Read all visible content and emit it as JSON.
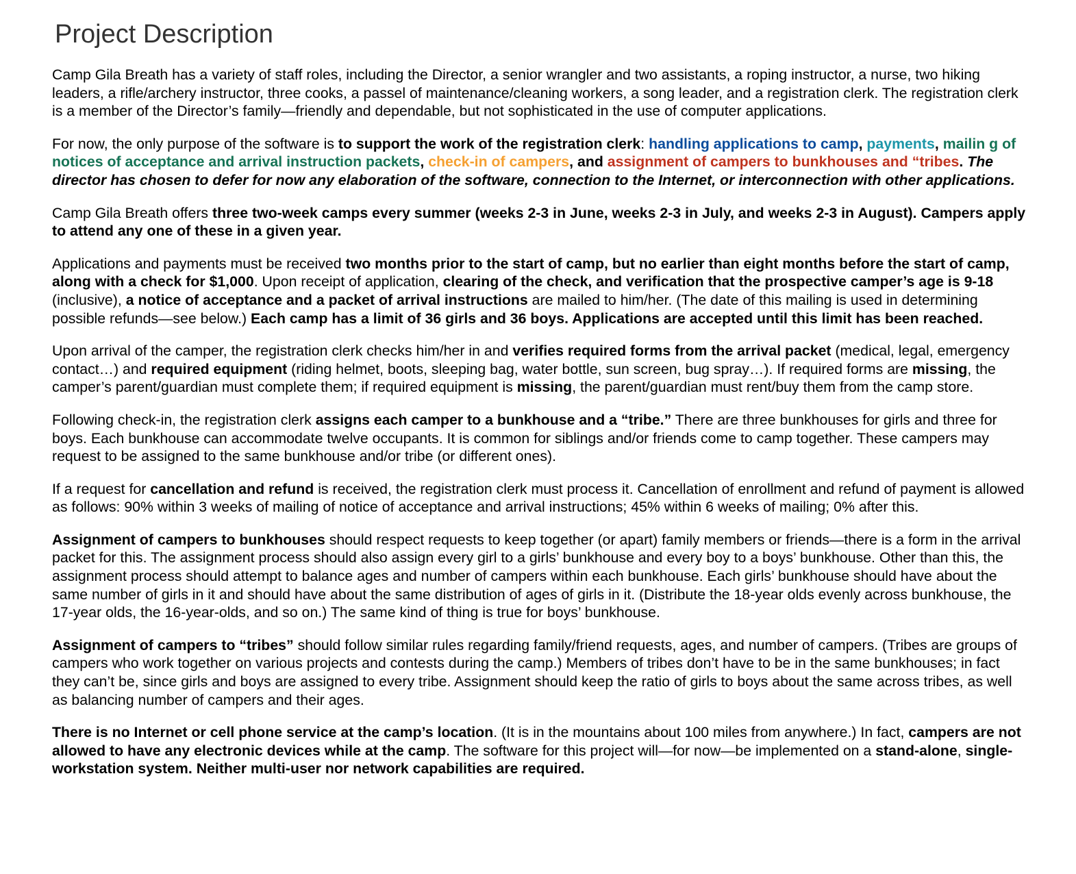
{
  "title": "Project Description",
  "colors": {
    "title": "#333333",
    "handling": "#0b4c9c",
    "payments": "#1c96a8",
    "mailing": "#167355",
    "checkin": "#f5a032",
    "assignment": "#c0341f"
  },
  "p1": {
    "s1": "Camp Gila Breath has a variety of staff roles, including the Director, a senior wrangler and two assistants, a roping instructor, a nurse, two hiking leaders, a rifle/archery instructor, three cooks, a passel of maintenance/cleaning workers, a song leader, and a registration clerk. The registration clerk is a member of the Director’s family—friendly and dependable, but not sophisticated in the use of computer applications."
  },
  "p2": {
    "s1": "For now, the only purpose of the software is ",
    "s2": "to support the work of the registration clerk",
    "s3": ": ",
    "s4": "handling applications to camp",
    "s5": ", ",
    "s6": "payments",
    "s7": ", ",
    "s8": "mailin g of notices of acceptance and arrival instruction packets",
    "s9": ", ",
    "s10": "check-in of campers",
    "s11": ", and ",
    "s12": "assignment of campers to bunkhouses and “tribes",
    "s13": ". ",
    "s14": "The director has chosen to defer for now any elaboration of the software, connection to the Internet, or interconnection with other applications."
  },
  "p3": {
    "s1": "Camp Gila Breath offers ",
    "s2": "three two-week camps every summer (weeks 2-3 in June, weeks 2-3 in July, and weeks 2-3 in August). Campers apply to attend any one of these in a given year."
  },
  "p4": {
    "s1": "Applications and payments must be received ",
    "s2": "two months prior to the start of camp, but no earlier than eight months before the start of camp, along with a check for $1,000",
    "s3": ". Upon receipt of application, ",
    "s4": "clearing of the check, and verification that the prospective camper’s age is 9-18",
    "s5": " (inclusive), ",
    "s6": "a notice of acceptance and a packet of arrival instructions",
    "s7": " are mailed to him/her. (The date of this mailing is used in determining possible refunds—see below.) ",
    "s8": "Each camp has a limit of 36 girls and 36 boys. Applications are accepted until this limit has been reached."
  },
  "p5": {
    "s1": "Upon arrival of the camper, the registration clerk checks him/her in and ",
    "s2": "verifies required forms from the arrival packet",
    "s3": " (medical, legal, emergency contact…) and ",
    "s4": "required equipment",
    "s5": " (riding helmet, boots, sleeping bag, water bottle, sun screen, bug spray…). If required forms are ",
    "s6": "missing",
    "s7": ", the camper’s parent/guardian must complete them; if required equipment is ",
    "s8": "missing",
    "s9": ", the parent/guardian must rent/buy them from the camp store."
  },
  "p6": {
    "s1": "Following check-in, the registration clerk ",
    "s2": "assigns each camper to a bunkhouse and a “tribe.”",
    "s3": " There are three bunkhouses for girls and three for boys. Each bunkhouse can accommodate twelve occupants. It is common for siblings and/or friends come to camp together. These campers may request to be assigned to the same bunkhouse and/or tribe (or different ones)."
  },
  "p7": {
    "s1": "If a request for ",
    "s2": "cancellation and refund",
    "s3": " is received, the registration clerk must process it. Cancellation of enrollment and refund of payment is allowed as follows: 90% within 3 weeks of mailing of notice of acceptance and arrival instructions; 45% within 6 weeks of mailing; 0% after this."
  },
  "p8": {
    "s1": "Assignment of campers to bunkhouses",
    "s2": " should respect requests to keep together (or apart) family members or friends—there is a form in the arrival packet for this. The assignment process should also assign every girl to a girls’ bunkhouse and every boy to a boys’ bunkhouse. Other than this, the assignment process should attempt to balance ages and number of campers within each bunkhouse. Each girls’ bunkhouse should have about the same number of girls in it and should have about the same distribution of ages of girls in it. (Distribute the 18-year olds evenly across bunkhouse, the 17-year olds, the 16-year-olds, and so on.) The same kind of thing is true for boys’ bunkhouse."
  },
  "p9": {
    "s1": "Assignment of campers to “tribes”",
    "s2": " should follow similar rules regarding family/friend requests, ages, and number of campers. (Tribes are groups of campers who work together on various projects and contests during the camp.) Members of tribes don’t have to be in the same bunkhouses; in fact they can’t be, since girls and boys are assigned to every tribe. Assignment should keep the ratio of girls to boys about the same across tribes, as well as balancing number of campers and their ages."
  },
  "p10": {
    "s1": "There is no Internet or cell phone service at the camp’s location",
    "s2": ". (It is in the mountains about 100 miles from anywhere.) In fact, ",
    "s3": "campers are not allowed to have any electronic devices while at the camp",
    "s4": ". The software for this project will—for now—be implemented on a ",
    "s5": "stand-alone",
    "s6": ", ",
    "s7": "single-workstation system",
    "s8": ". ",
    "s9": "Neither multi-user nor network capabilities are required."
  }
}
